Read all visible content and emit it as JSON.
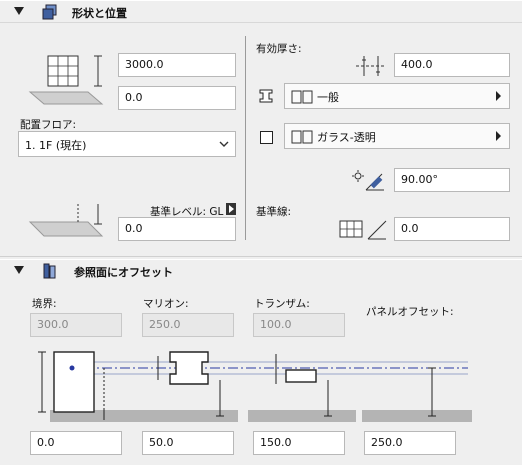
{
  "geometry": {
    "title": "形状と位置",
    "height_value": "3000.0",
    "offset_value": "0.0",
    "floor_label": "配置フロア:",
    "floor_value": "1. 1F (現在)",
    "ref_level_label": "基準レベル: GL",
    "ref_offset_value": "0.0",
    "thickness_label": "有効厚さ:",
    "thickness_value": "400.0",
    "profile_select": "一般",
    "material_select": "ガラス-透明",
    "angle_value": "90.00°",
    "ref_line_label": "基準線:",
    "ref_line_value": "0.0"
  },
  "offset": {
    "title": "参照面にオフセット",
    "boundary_label": "境界:",
    "boundary_ro": "300.0",
    "mullion_label": "マリオン:",
    "mullion_ro": "250.0",
    "transom_label": "トランザム:",
    "transom_ro": "100.0",
    "panel_label": "パネルオフセット:",
    "boundary_value": "0.0",
    "mullion_value": "50.0",
    "transom_value": "150.0",
    "panel_value": "250.0"
  }
}
